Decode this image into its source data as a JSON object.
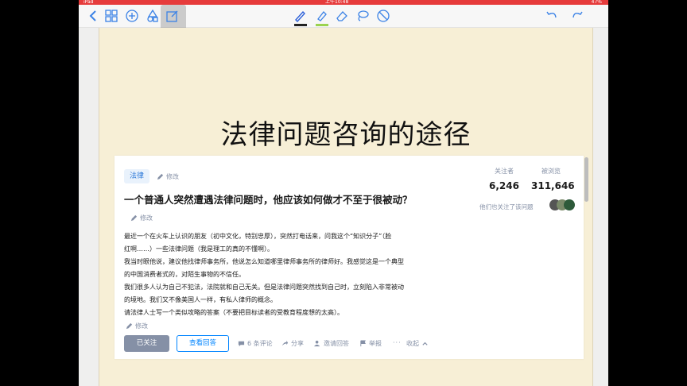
{
  "status_bar": {
    "left": "iPad",
    "center": "上午10:48",
    "right": "47%"
  },
  "colors": {
    "accent": "#3b82e6",
    "zhihu_blue": "#0084ff",
    "page_bg": "#f7efd6",
    "status_red": "#e63b3b"
  },
  "toolbar": {
    "left_icons": [
      "back-icon",
      "grid-icon",
      "add-icon",
      "shapes-icon",
      "edit-icon"
    ],
    "center_icons": [
      "pen-icon",
      "highlighter-icon",
      "eraser-icon",
      "lasso-icon",
      "no-touch-icon"
    ],
    "right_icons": [
      "undo-icon",
      "redo-icon"
    ]
  },
  "page": {
    "title": "法律问题咨询的途径"
  },
  "card": {
    "topic": "法律",
    "edit_label": "修改",
    "followers_label": "关注者",
    "followers_count": "6,246",
    "views_label": "被浏览",
    "views_count": "311,646",
    "followed_note": "他们也关注了该问题",
    "question_title": "一个普通人突然遭遇法律问题时，他应该如何做才不至于很被动？",
    "description": [
      "最近一个在火车上认识的朋友（初中文化，特别忠厚），突然打电话来，问我这个“知识分子”（脸",
      "红啊……）一些法律问题（我是理工的真的不懂啊）。",
      "我当时眼他说，建议他找律师事务所，他说怎么知道哪里律师事务所的律师好。我感觉这是一个典型",
      "的中国消费者式的，对陌生事物的不信任。",
      "我们很多人认为自己不犯法，法院就和自己无关。但是法律问题突然找到自己时，立刻陷入非常被动",
      "的境地。我们又不像美国人一样，有私人律师的概念。",
      "请法律人士写一个类似攻略的答案（不要把目标读者的受教育程度想的太高）。"
    ],
    "follow_button": "已关注",
    "answers_button": "查看回答",
    "comments": "6 条评论",
    "share": "分享",
    "invite": "邀请回答",
    "report": "举报",
    "collapse": "收起"
  }
}
